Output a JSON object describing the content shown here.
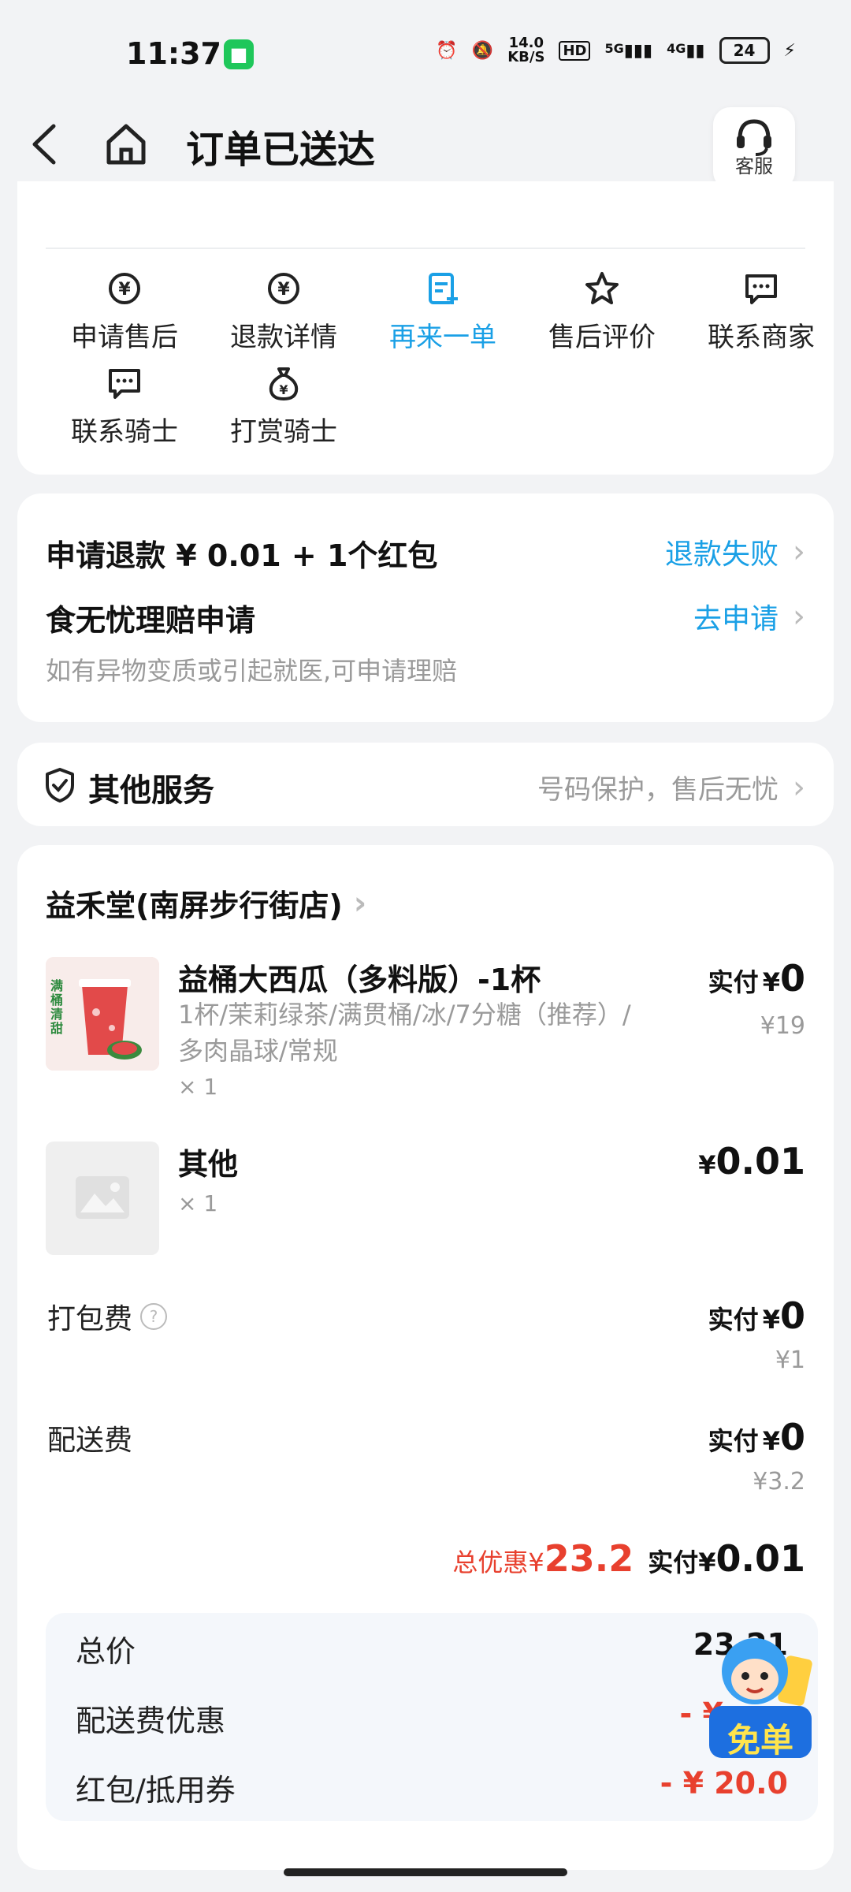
{
  "status_bar": {
    "time": "11:37",
    "net_speed": "14.0",
    "net_unit": "KB/S",
    "hd": "HD",
    "net_5g": "5G",
    "net_4g": "4G",
    "battery": "24"
  },
  "header": {
    "title": "订单已送达",
    "service_label": "客服"
  },
  "actions": [
    {
      "label": "申请售后",
      "icon": "yuan-refresh-icon"
    },
    {
      "label": "退款详情",
      "icon": "yuan-refresh-icon"
    },
    {
      "label": "再来一单",
      "icon": "reorder-icon",
      "accent": "#1aa0e6"
    },
    {
      "label": "售后评价",
      "icon": "star-icon"
    },
    {
      "label": "联系商家",
      "icon": "chat-icon"
    },
    {
      "label": "联系骑士",
      "icon": "chat-icon"
    },
    {
      "label": "打赏骑士",
      "icon": "money-bag-icon"
    }
  ],
  "refund": {
    "title": "申请退款 ¥ 0.01 + 1个红包",
    "status": "退款失败",
    "compensation_title": "食无忧理赔申请",
    "compensation_action": "去申请",
    "compensation_desc": "如有异物变质或引起就医,可申请理赔"
  },
  "other_services": {
    "title": "其他服务",
    "desc": "号码保护，售后无忧"
  },
  "order": {
    "store": "益禾堂(南屏步行街店)",
    "items": [
      {
        "name": "益桶大西瓜（多料版）-1杯",
        "spec": "1杯/茉莉绿茶/满贯桶/冰/7分糖（推荐）/多肉晶球/常规",
        "qty": "× 1",
        "pay_label": "实付",
        "currency": "¥",
        "pay": "0",
        "original": "¥19",
        "thumb_text": "满桶清甜"
      },
      {
        "name": "其他",
        "qty": "× 1",
        "currency": "¥",
        "pay": "0.01"
      }
    ],
    "fees": [
      {
        "label": "打包费",
        "pay_label": "实付",
        "currency": "¥",
        "pay": "0",
        "original": "¥1"
      },
      {
        "label": "配送费",
        "pay_label": "实付",
        "currency": "¥",
        "pay": "0",
        "original": "¥3.2"
      }
    ],
    "summary": {
      "discount_label": "总优惠",
      "currency": "¥",
      "discount": "23.2",
      "paid_label": "实付",
      "paid": "0.01"
    },
    "details": [
      {
        "label": "总价",
        "value": "23.21"
      },
      {
        "label": "配送费优惠",
        "value": "- ¥"
      },
      {
        "label": "红包/抵用券",
        "value": "- ¥ 20.0"
      }
    ],
    "badge_text": "免单"
  },
  "colors": {
    "accent_blue": "#1aa0e6",
    "discount_red": "#e8402e"
  }
}
